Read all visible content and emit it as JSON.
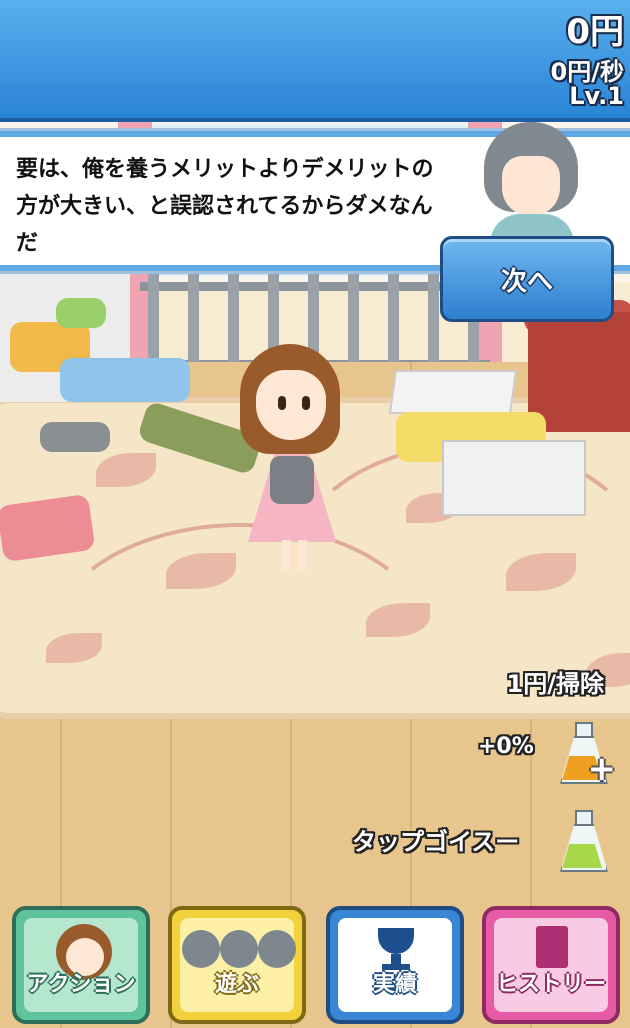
{
  "header": {
    "money": "0円",
    "rate": "0円/秒",
    "level": "Lv.1"
  },
  "dialog": {
    "text": "要は、俺を養うメリットよりデメリットの方が大きい、と誤認されてるからダメなんだ",
    "next_label": "次へ"
  },
  "info": {
    "per_clean": "1円/掃除",
    "bonus_percent": "+0%",
    "tap_item": "タップゴイスー"
  },
  "nav": {
    "action": "アクション",
    "play": "遊ぶ",
    "achievements": "実績",
    "history": "ヒストリー"
  },
  "colors": {
    "header_blue": "#2a84d6",
    "action_green": "#5fc49e",
    "play_yellow": "#f2d13c",
    "achievements_blue": "#3a86d6",
    "history_pink": "#e65aa6"
  },
  "icons": {
    "bonus_potion": "orange-flask-plus-icon",
    "tap_potion": "green-yen-flask-icon",
    "achievements": "trophy-icon",
    "history": "notebook-icon"
  }
}
